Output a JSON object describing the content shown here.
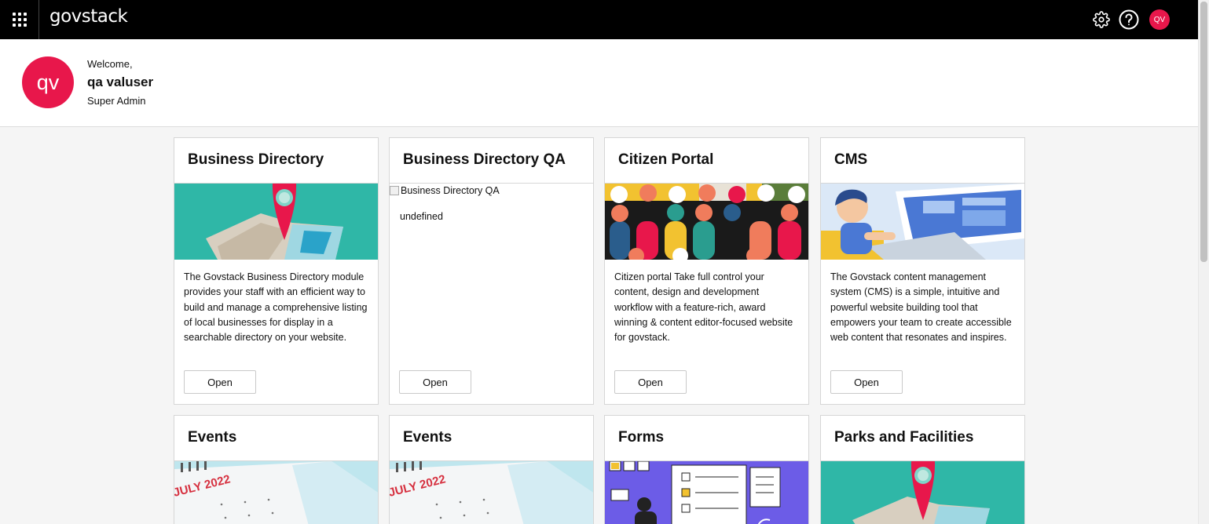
{
  "topbar": {
    "logo": "govstack",
    "user_initials": "QV"
  },
  "welcome": {
    "greeting": "Welcome,",
    "name": "qa valuser",
    "role": "Super Admin",
    "avatar_initials": "qv"
  },
  "colors": {
    "accent": "#e8174b",
    "topbar": "#000000"
  },
  "cards": [
    {
      "title": "Business Directory",
      "description": "The Govstack Business Directory module provides your staff with an efficient way to build and manage a comprehensive listing of local businesses for display in a searchable directory on your website.",
      "button": "Open",
      "image": "map-pin-illustration"
    },
    {
      "title": "Business Directory QA",
      "image_alt": "Business Directory QA",
      "description": "undefined",
      "button": "Open",
      "image": "broken-image"
    },
    {
      "title": "Citizen Portal",
      "description": "Citizen portal Take full control your content, design and development workflow with a feature-rich, award winning & content editor-focused website for govstack.",
      "button": "Open",
      "image": "people-silhouettes-illustration"
    },
    {
      "title": "CMS",
      "description": "The Govstack content management system (CMS) is a simple, intuitive and powerful website building tool that empowers your team to create accessible web content that resonates and inspires.",
      "button": "Open",
      "image": "person-at-computer-illustration"
    },
    {
      "title": "Events",
      "calendar_label": "JULY 2022",
      "image": "calendar-illustration"
    },
    {
      "title": "Events",
      "calendar_label": "JULY 2022",
      "image": "calendar-illustration"
    },
    {
      "title": "Forms",
      "image": "forms-illustration"
    },
    {
      "title": "Parks and Facilities",
      "image": "map-pin-illustration"
    }
  ]
}
